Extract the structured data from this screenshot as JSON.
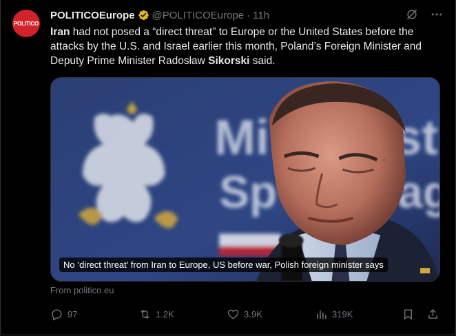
{
  "author": {
    "avatar_text": "POLITICO",
    "display_name": "POLITICOEurope",
    "handle": "@POLITICOEurope",
    "separator": "·",
    "time": "11h",
    "verified_color": "#e2b719"
  },
  "tweet": {
    "segments": [
      {
        "text": "Iran",
        "bold": true
      },
      {
        "text": " had not posed a “direct threat” to Europe or the United States before the attacks by the U.S. and Israel earlier this month, Poland’s Foreign Minister and Deputy Prime Minister Radosław ",
        "bold": false
      },
      {
        "text": "Sikorski",
        "bold": true
      },
      {
        "text": " said.",
        "bold": false
      }
    ]
  },
  "media": {
    "caption": "No ‘direct threat’ from Iran to Europe, US before war, Polish foreign minister says",
    "backdrop_letters_line1": "Mi",
    "backdrop_letters_line1b": "st",
    "backdrop_letters_line2": "Sp",
    "backdrop_letters_line2b": "ag"
  },
  "source": "From politico.eu",
  "stats": {
    "replies": "97",
    "reposts": "1.2K",
    "likes": "3.9K",
    "views": "319K"
  },
  "icons": {
    "grok": "grok-icon",
    "more": "more-icon",
    "reply": "reply-icon",
    "repost": "repost-icon",
    "like": "heart-icon",
    "views": "views-icon",
    "bookmark": "bookmark-icon",
    "share": "share-icon"
  },
  "colors": {
    "background": "#000000",
    "text": "#e7e9ea",
    "muted": "#71767b",
    "brand_red": "#d2232a"
  }
}
